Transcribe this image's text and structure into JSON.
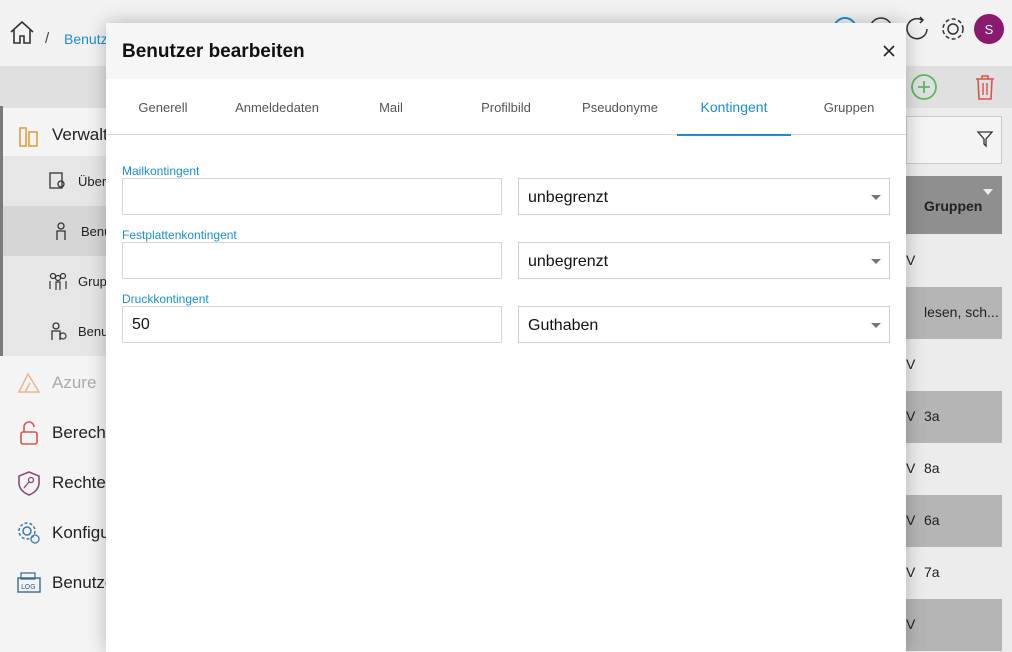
{
  "app": {
    "breadcrumb": {
      "separator": "/",
      "current": "Benutz"
    },
    "avatar_initial": "S",
    "sidebar": {
      "items": [
        {
          "label": "Verwalt",
          "icon": "users-building-icon"
        },
        {
          "label": "Über",
          "icon": "document-search-icon"
        },
        {
          "label": "Benu",
          "icon": "person-icon"
        },
        {
          "label": "Grup",
          "icon": "group-icon"
        },
        {
          "label": "Benu",
          "icon": "person-info-icon"
        },
        {
          "label": "Azure",
          "icon": "azure-icon"
        },
        {
          "label": "Berecht",
          "icon": "lock-open-icon"
        },
        {
          "label": "Rechtev",
          "icon": "shield-key-icon"
        },
        {
          "label": "Konfigu",
          "icon": "gear-icon"
        },
        {
          "label": "Benutze",
          "icon": "log-icon"
        }
      ]
    },
    "table": {
      "column_header": "Gruppen",
      "rows": [
        {
          "prefix": "V",
          "value": ""
        },
        {
          "prefix": "",
          "value": "lesen, sch..."
        },
        {
          "prefix": "V",
          "value": ""
        },
        {
          "prefix": "V",
          "value": "3a"
        },
        {
          "prefix": "V",
          "value": "8a"
        },
        {
          "prefix": "V",
          "value": "6a"
        },
        {
          "prefix": "V",
          "value": "7a"
        },
        {
          "prefix": "V",
          "value": ""
        }
      ]
    }
  },
  "modal": {
    "title": "Benutzer bearbeiten",
    "tabs": [
      {
        "label": "Generell"
      },
      {
        "label": "Anmeldedaten"
      },
      {
        "label": "Mail"
      },
      {
        "label": "Profilbild"
      },
      {
        "label": "Pseudonyme"
      },
      {
        "label": "Kontingent"
      },
      {
        "label": "Gruppen"
      }
    ],
    "active_tab": "Kontingent",
    "fields": [
      {
        "label": "Mailkontingent",
        "value": "",
        "unit": "unbegrenzt"
      },
      {
        "label": "Festplattenkontingent",
        "value": "",
        "unit": "unbegrenzt"
      },
      {
        "label": "Druckkontingent",
        "value": "50",
        "unit": "Guthaben"
      }
    ]
  },
  "colors": {
    "accent": "#1a8fd0",
    "avatar": "#8a1a6e",
    "add": "#5cb85c",
    "delete": "#d9534f"
  }
}
